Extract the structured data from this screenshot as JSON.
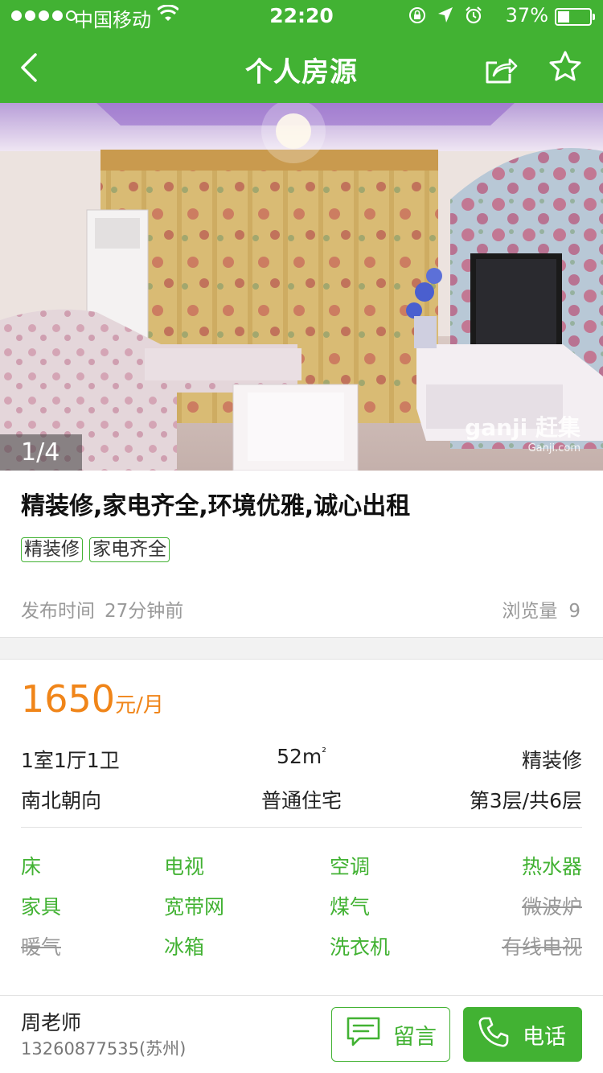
{
  "status_bar": {
    "carrier": "中国移动",
    "time": "22:20",
    "battery": "37%",
    "battery_level": 0.37,
    "icons": [
      "signal-dots",
      "wifi-icon",
      "orientation-lock-icon",
      "location-arrow-icon",
      "alarm-icon",
      "battery-icon"
    ]
  },
  "nav": {
    "title": "个人房源",
    "icons": [
      "back-chevron-icon",
      "share-icon",
      "star-icon"
    ]
  },
  "photo": {
    "counter": "1/4",
    "watermark_brand": "ganji 赶集",
    "watermark_domain": "Ganji.com"
  },
  "listing": {
    "title": "精装修,家电齐全,环境优雅,诚心出租",
    "tags": [
      "精装修",
      "家电齐全"
    ],
    "publish_label": "发布时间",
    "publish_value": "27分钟前",
    "views_label": "浏览量",
    "views_value": "9"
  },
  "price": {
    "amount": "1650",
    "unit": "元/月"
  },
  "specs": {
    "rooms": "1室1厅1卫",
    "area": "52m",
    "area_unit_sup": "²",
    "decoration": "精装修",
    "orientation": "南北朝向",
    "type": "普通住宅",
    "floor": "第3层/共6层"
  },
  "amenities": [
    {
      "label": "床",
      "available": true
    },
    {
      "label": "电视",
      "available": true
    },
    {
      "label": "空调",
      "available": true
    },
    {
      "label": "热水器",
      "available": true
    },
    {
      "label": "家具",
      "available": true
    },
    {
      "label": "宽带网",
      "available": true
    },
    {
      "label": "煤气",
      "available": true
    },
    {
      "label": "微波炉",
      "available": false
    },
    {
      "label": "暖气",
      "available": false
    },
    {
      "label": "冰箱",
      "available": true
    },
    {
      "label": "洗衣机",
      "available": true
    },
    {
      "label": "有线电视",
      "available": false
    }
  ],
  "contact": {
    "name": "周老师",
    "phone": "13260877535(苏州)",
    "message_label": "留言",
    "call_label": "电话"
  },
  "colors": {
    "brand_green": "#42b233",
    "price_orange": "#f08519",
    "muted_gray": "#999999"
  }
}
